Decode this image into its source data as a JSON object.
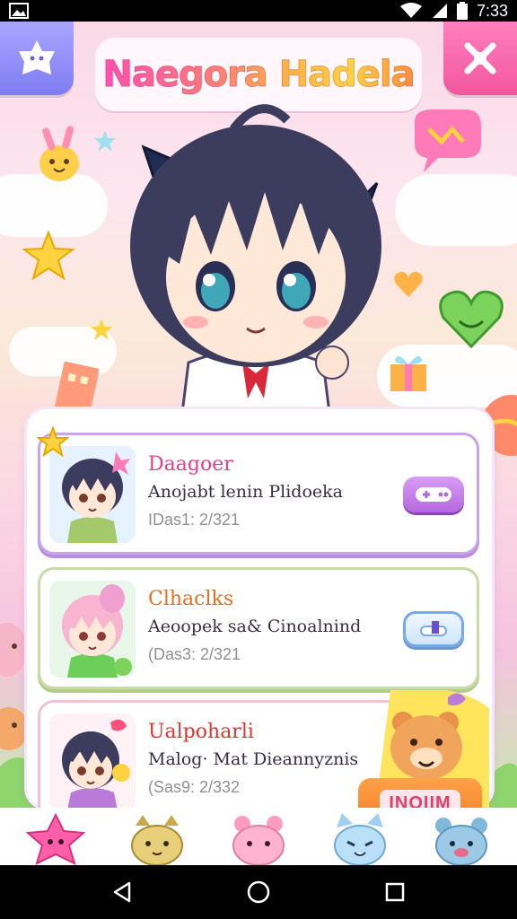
{
  "status_bar": {
    "time": "7:33",
    "icons": [
      "image-icon",
      "wifi-icon",
      "signal-icon",
      "battery-icon"
    ]
  },
  "header": {
    "title": "Naegora Hadela",
    "left_button_icon": "ghost-star-icon",
    "right_button_icon": "crossed-bones-icon"
  },
  "cards": [
    {
      "title": "Daagoer",
      "subtitle": "Anojabt lenin Plidoeka",
      "days": "IDas1: 2/321",
      "title_color": "#e23f86",
      "action_icon": "controller-icon"
    },
    {
      "title": "Clhaclks",
      "subtitle": "Aeoopek sa& Cinoalnind",
      "days": "(Das3: 2/321",
      "title_color": "#e2701f",
      "action_icon": "flag-icon"
    },
    {
      "title": "Ualpoharli",
      "subtitle": "Malog· Mat Dieannyznis",
      "days": "(Sas9: 2/332",
      "title_color": "#e2342f",
      "join_label": "INOIIM"
    }
  ],
  "bottom_bar": {
    "characters": [
      "pink-star-icon",
      "yellow-cat-icon",
      "pink-bear-icon",
      "blue-cat-icon",
      "blue-bear-icon"
    ]
  },
  "nav_bar": {
    "buttons": [
      "back-icon",
      "home-icon",
      "recents-icon"
    ]
  },
  "colors": {
    "accent_pink": "#f2569f",
    "accent_purple": "#7f7cf2",
    "join_orange": "#f47b1f"
  }
}
